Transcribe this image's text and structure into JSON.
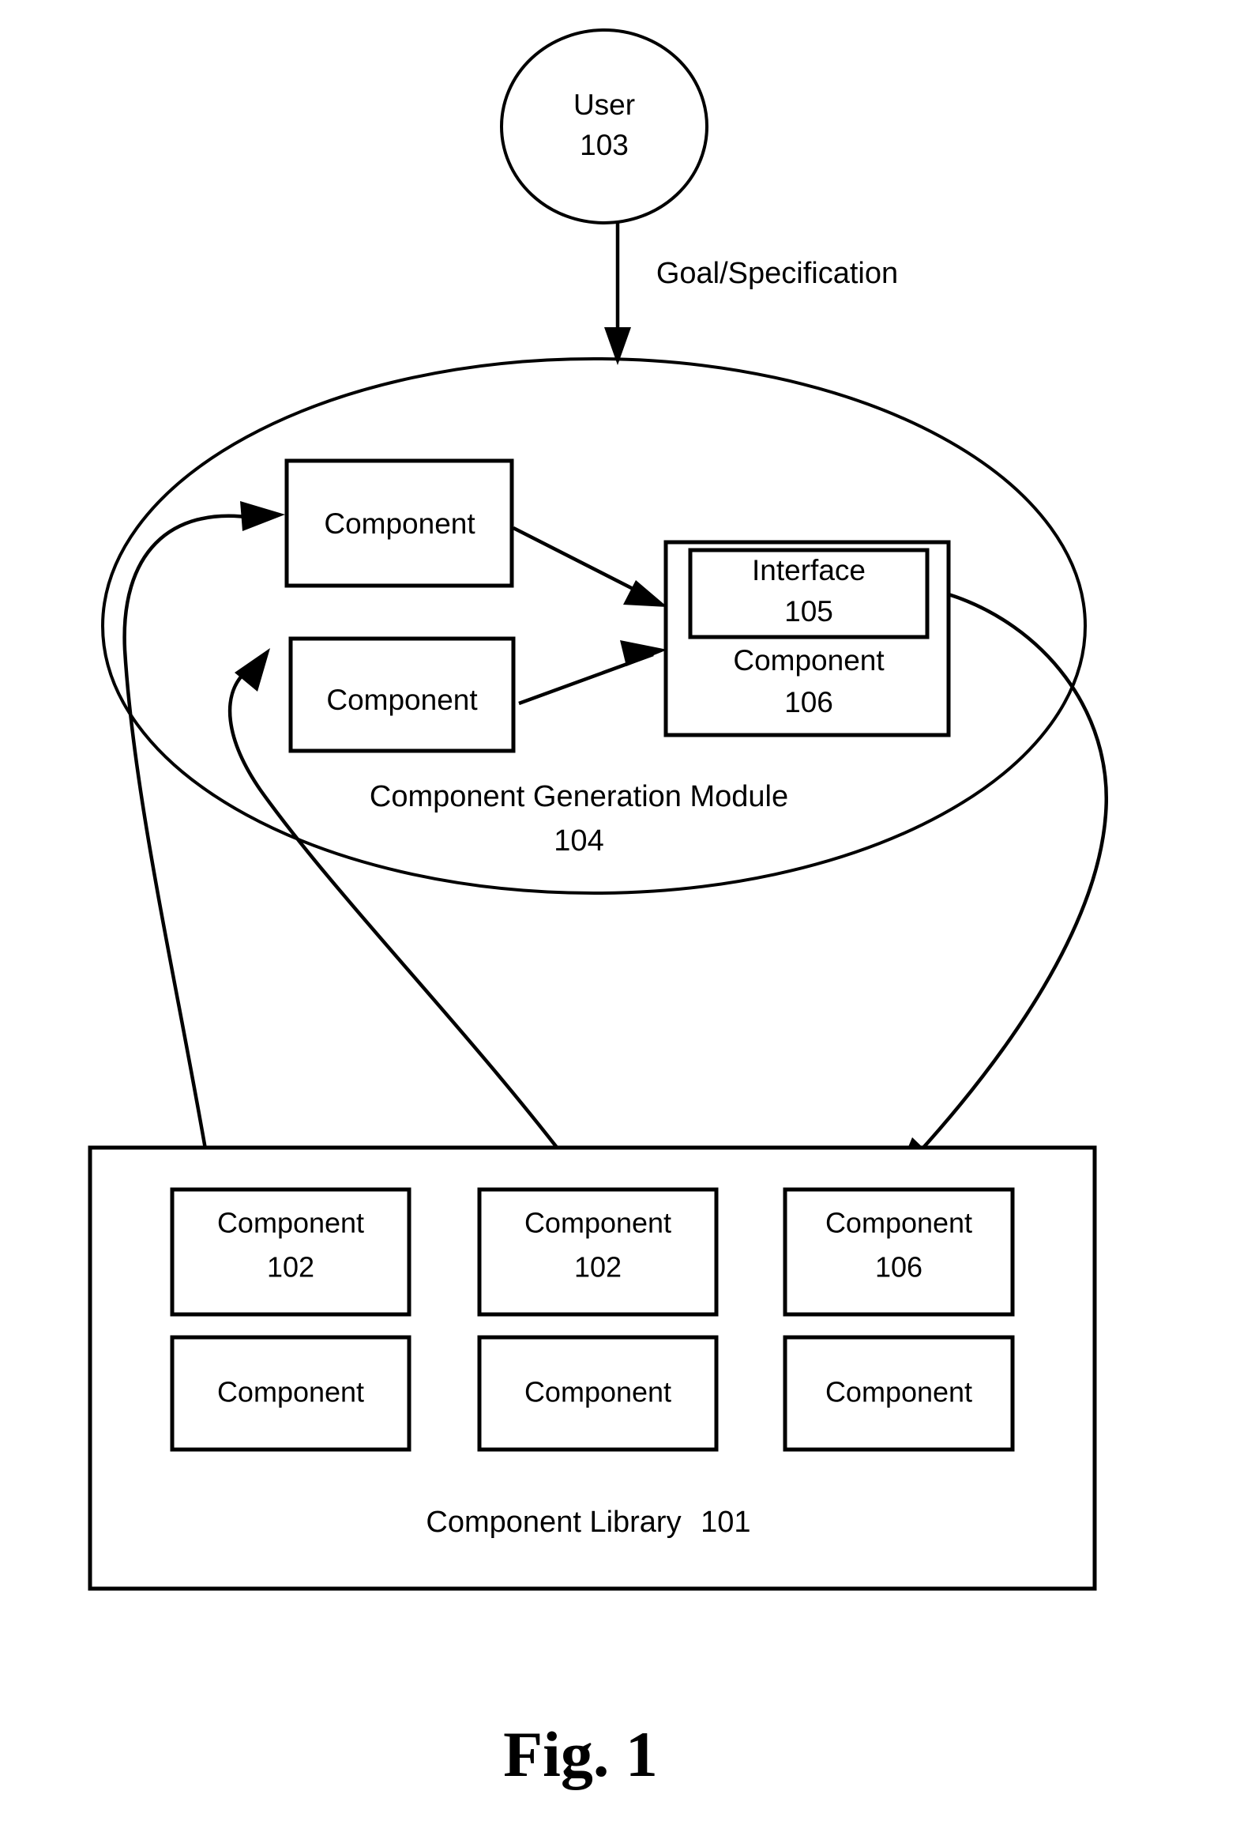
{
  "figure": {
    "caption": "Fig. 1"
  },
  "actor": {
    "name": "User",
    "ref": "103"
  },
  "flow": {
    "goal_label": "Goal/Specification"
  },
  "module": {
    "title": "Component Generation Module",
    "ref": "104",
    "inner_components": [
      {
        "label": "Component"
      },
      {
        "label": "Component"
      }
    ],
    "assembled": {
      "interface_label": "Interface",
      "interface_ref": "105",
      "component_label": "Component",
      "component_ref": "106"
    }
  },
  "library": {
    "title": "Component Library",
    "ref": "101",
    "rows": [
      [
        {
          "label": "Component",
          "ref": "102"
        },
        {
          "label": "Component",
          "ref": "102"
        },
        {
          "label": "Component",
          "ref": "106"
        }
      ],
      [
        {
          "label": "Component",
          "ref": ""
        },
        {
          "label": "Component",
          "ref": ""
        },
        {
          "label": "Component",
          "ref": ""
        }
      ]
    ]
  },
  "colors": {
    "ink": "#000000",
    "paper": "#ffffff"
  }
}
